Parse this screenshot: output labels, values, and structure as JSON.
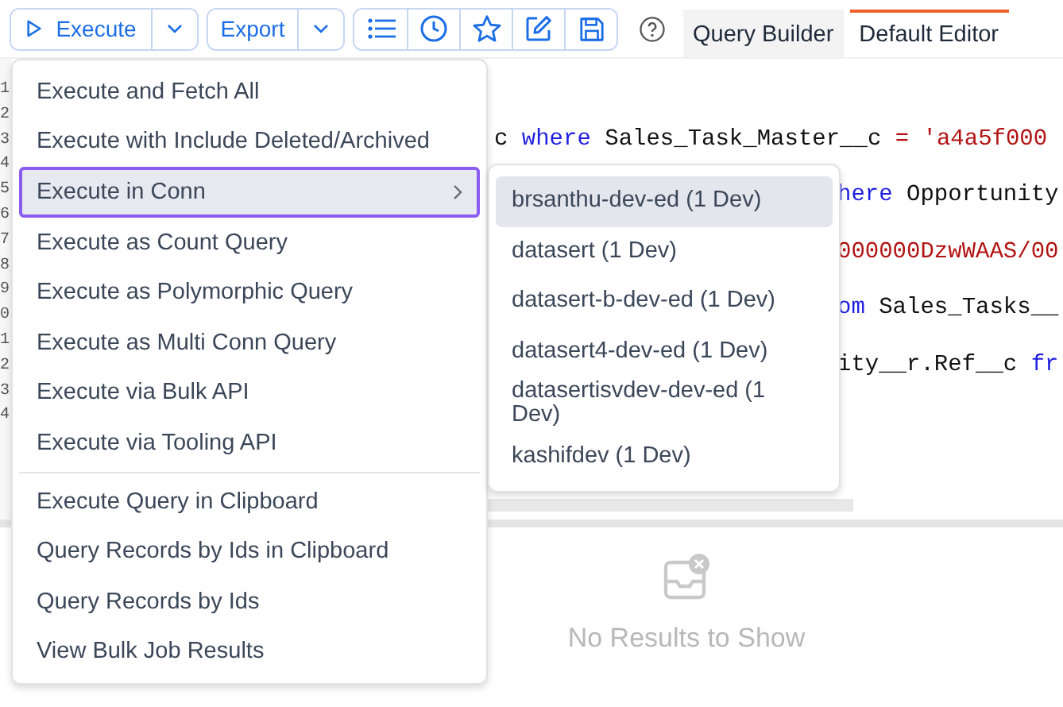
{
  "toolbar": {
    "execute": {
      "label": "Execute"
    },
    "export": {
      "label": "Export"
    },
    "tabs": [
      {
        "label": "Query Builder",
        "selected": false
      },
      {
        "label": "Default Editor",
        "selected": true
      }
    ]
  },
  "editor": {
    "line_numbers": [
      "1",
      "2",
      "3",
      "4",
      "5",
      "6",
      "7",
      "8",
      "9",
      "0",
      "1",
      "2",
      "3",
      "4"
    ],
    "code_lines": [
      {
        "kind": "beside_menu",
        "tokens": [
          {
            "kind": "plain",
            "text": "c "
          },
          {
            "kind": "keyword",
            "text": "where"
          },
          {
            "kind": "plain",
            "text": " Sales_Task_Master__c "
          },
          {
            "kind": "string",
            "text": "= 'a4a5f000"
          }
        ]
      },
      {
        "kind": "beside_submenu",
        "tokens": [
          {
            "kind": "keyword",
            "text": "here"
          },
          {
            "kind": "plain",
            "text": " Opportunity"
          }
        ]
      },
      {
        "kind": "beside_submenu",
        "tokens": [
          {
            "kind": "string",
            "text": "000000DzwWAAS/00"
          }
        ]
      },
      {
        "kind": "beside_submenu",
        "tokens": [
          {
            "kind": "keyword",
            "text": "om"
          },
          {
            "kind": "plain",
            "text": " Sales_Tasks__"
          }
        ]
      },
      {
        "kind": "beside_submenu",
        "tokens": [
          {
            "kind": "plain",
            "text": "ity__r.Ref__c "
          },
          {
            "kind": "keyword",
            "text": "fr"
          }
        ]
      }
    ]
  },
  "menu": {
    "groups": [
      [
        {
          "label": "Execute and Fetch All",
          "selected": false,
          "has_submenu": false
        },
        {
          "label": "Execute with Include Deleted/Archived",
          "selected": false,
          "has_submenu": false
        },
        {
          "label": "Execute in Conn",
          "selected": true,
          "has_submenu": true
        },
        {
          "label": "Execute as Count Query",
          "selected": false,
          "has_submenu": false
        },
        {
          "label": "Execute as Polymorphic Query",
          "selected": false,
          "has_submenu": false
        },
        {
          "label": "Execute as Multi Conn Query",
          "selected": false,
          "has_submenu": false
        },
        {
          "label": "Execute via Bulk API",
          "selected": false,
          "has_submenu": false
        },
        {
          "label": "Execute via Tooling API",
          "selected": false,
          "has_submenu": false
        }
      ],
      [
        {
          "label": "Execute Query in Clipboard",
          "selected": false,
          "has_submenu": false
        },
        {
          "label": "Query Records by Ids in Clipboard",
          "selected": false,
          "has_submenu": false
        },
        {
          "label": "Query Records by Ids",
          "selected": false,
          "has_submenu": false
        },
        {
          "label": "View Bulk Job Results",
          "selected": false,
          "has_submenu": false
        }
      ]
    ]
  },
  "submenu": {
    "items": [
      {
        "label": "brsanthu-dev-ed (1 Dev)",
        "selected": true
      },
      {
        "label": "datasert (1 Dev)",
        "selected": false
      },
      {
        "label": "datasert-b-dev-ed (1 Dev)",
        "selected": false
      },
      {
        "label": "datasert4-dev-ed (1 Dev)",
        "selected": false
      },
      {
        "label": "datasertisvdev-dev-ed (1 Dev)",
        "selected": false
      },
      {
        "label": "kashifdev (1 Dev)",
        "selected": false
      }
    ]
  },
  "results": {
    "empty_message": "No Results to Show"
  }
}
